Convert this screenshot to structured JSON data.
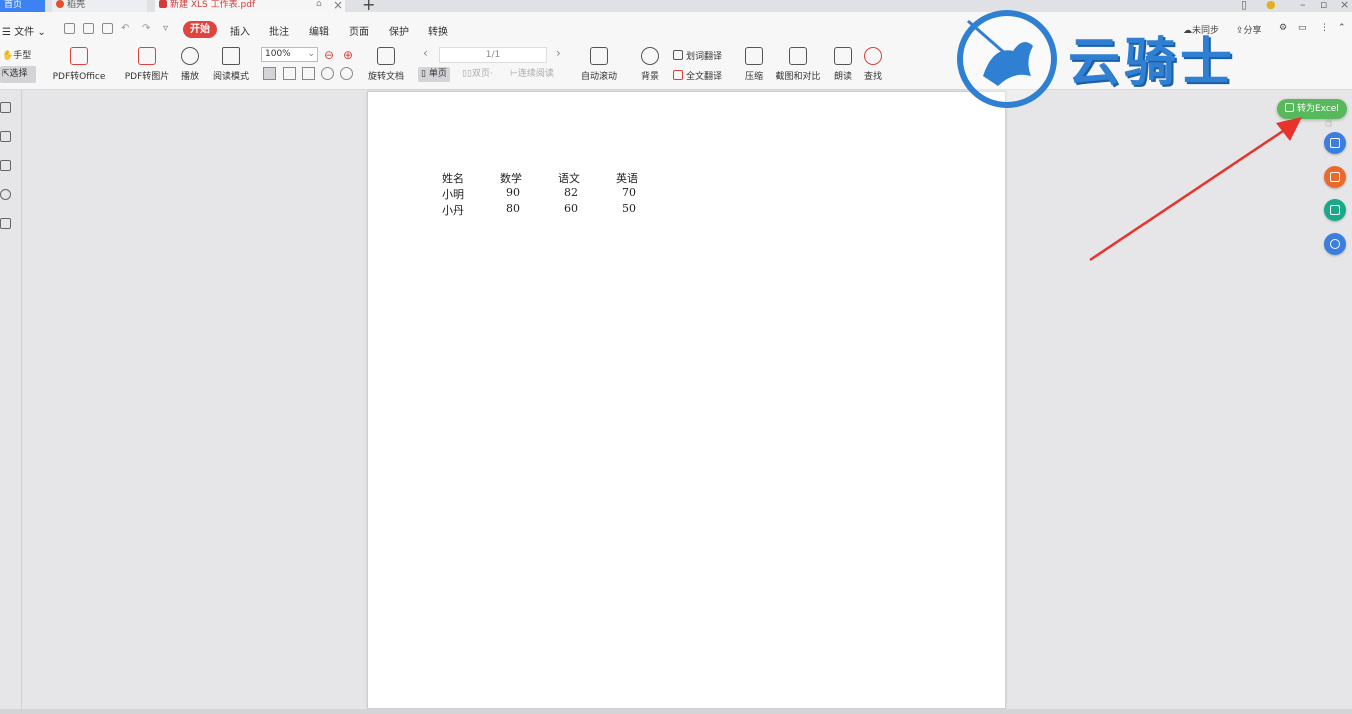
{
  "tabs": {
    "home": "首页",
    "daoke": "稻壳",
    "file": "新建 XLS 工作表.pdf"
  },
  "menu": {
    "file": "文件",
    "items": [
      "开始",
      "插入",
      "批注",
      "编辑",
      "页面",
      "保护",
      "转换"
    ],
    "active": "开始",
    "sync": "未同步",
    "share": "分享"
  },
  "ribbon": {
    "hand": "手型",
    "select": "选择",
    "pdf_to_office": "PDF转Office",
    "pdf_to_image": "PDF转图片",
    "play": "播放",
    "read_mode": "阅读模式",
    "zoom": "100%",
    "rotate": "旋转文档",
    "page": "1/1",
    "single_page": "单页",
    "double_page": "双页",
    "continuous": "连续阅读",
    "auto_scroll": "自动滚动",
    "background": "背景",
    "word_translate": "划词翻译",
    "full_translate": "全文翻译",
    "compress": "压缩",
    "screenshot_compare": "截图和对比",
    "read_aloud": "朗读",
    "find": "查找"
  },
  "document": {
    "header": [
      "姓名",
      "数学",
      "语文",
      "英语"
    ],
    "rows": [
      [
        "小明",
        "90",
        "82",
        "70"
      ],
      [
        "小丹",
        "80",
        "60",
        "50"
      ]
    ]
  },
  "floating": {
    "to_excel": "转为Excel"
  },
  "watermark": {
    "text": "云骑士"
  },
  "colors": {
    "accent_red": "#e0443e",
    "excel_green": "#58b85c",
    "watermark_blue": "#2f7fd3",
    "arrow_red": "#e8332d"
  }
}
